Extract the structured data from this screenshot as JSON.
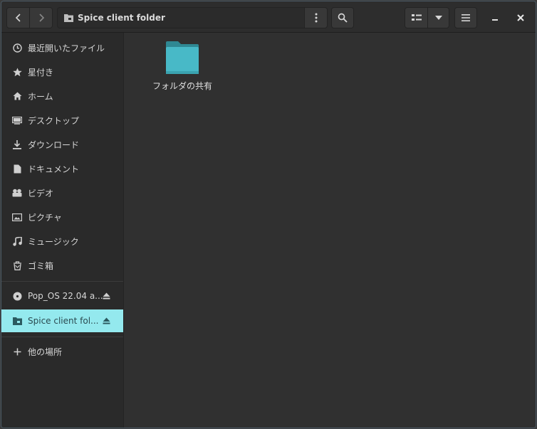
{
  "window": {
    "title": "Spice client folder"
  },
  "header": {
    "path_label": "Spice client folder",
    "icons": {
      "back": "chevron-left-icon",
      "forward": "chevron-right-icon",
      "folder": "folder-icon",
      "menu": "vertical-dots-icon",
      "search": "search-icon",
      "view": "list-view-icon",
      "view_dropdown": "chevron-down-icon",
      "hamburger": "hamburger-icon",
      "minimize": "minimize-icon",
      "close": "close-icon"
    }
  },
  "sidebar": {
    "items": [
      {
        "label": "最近開いたファイル",
        "icon": "clock-icon"
      },
      {
        "label": "星付き",
        "icon": "star-icon"
      },
      {
        "label": "ホーム",
        "icon": "home-icon"
      },
      {
        "label": "デスクトップ",
        "icon": "desktop-icon"
      },
      {
        "label": "ダウンロード",
        "icon": "download-icon"
      },
      {
        "label": "ドキュメント",
        "icon": "document-icon"
      },
      {
        "label": "ビデオ",
        "icon": "video-icon"
      },
      {
        "label": "ピクチャ",
        "icon": "picture-icon"
      },
      {
        "label": "ミュージック",
        "icon": "music-icon"
      },
      {
        "label": "ゴミ箱",
        "icon": "trash-icon"
      }
    ],
    "devices": [
      {
        "label": "Pop_OS 22.04 a...",
        "icon": "disc-icon",
        "eject": "eject-icon"
      },
      {
        "label": "Spice client fol...",
        "icon": "network-folder-icon",
        "eject": "eject-icon",
        "active": true
      }
    ],
    "other": {
      "label": "他の場所",
      "icon": "plus-icon"
    }
  },
  "content": {
    "items": [
      {
        "label": "フォルダの共有",
        "icon": "folder-icon"
      }
    ]
  },
  "colors": {
    "accent": "#94e9ee",
    "folder": "#48b9c7",
    "background": "#303030",
    "sidebar": "#2a2a2a"
  }
}
